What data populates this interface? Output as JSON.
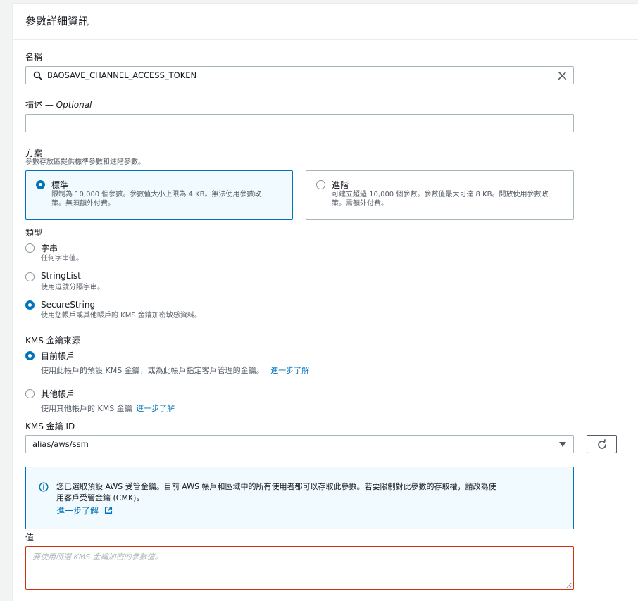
{
  "panel": {
    "title": "參數詳細資訊"
  },
  "name_field": {
    "label": "名稱",
    "value": "BAOSAVE_CHANNEL_ACCESS_TOKEN"
  },
  "description_field": {
    "label": "描述",
    "optional": "— Optional",
    "value": ""
  },
  "tier": {
    "label": "方案",
    "description": "參數存放區提供標準參數和進階參數。",
    "options": [
      {
        "title": "標準",
        "desc_line1": "限制為 10,000 個參數。參數值大小上限為 4 KB。無法使用參數政",
        "desc_line2": "策。無須額外付費。",
        "selected": true
      },
      {
        "title": "進階",
        "desc_line1": "可建立超過 10,000 個參數。參數值最大可達 8 KB。開放使用參數政",
        "desc_line2": "策。需額外付費。",
        "selected": false
      }
    ]
  },
  "type": {
    "label": "類型",
    "options": [
      {
        "title": "字串",
        "desc": "任何字串值。",
        "selected": false
      },
      {
        "title": "StringList",
        "desc": "使用逗號分隔字串。",
        "selected": false
      },
      {
        "title": "SecureString",
        "desc": "使用您帳戶或其他帳戶的 KMS 金鑰加密敏感資料。",
        "selected": true
      }
    ]
  },
  "kms_source": {
    "label": "KMS 金鑰來源",
    "options": [
      {
        "title": "目前帳戶",
        "desc": "使用此帳戶的預設 KMS 金鑰，或為此帳戶指定客戶管理的金鑰。",
        "link": "進一步了解",
        "selected": true
      },
      {
        "title": "其他帳戶",
        "desc": "使用其他帳戶的 KMS 金鑰",
        "link": "進一步了解",
        "selected": false
      }
    ]
  },
  "kms_key_id": {
    "label": "KMS 金鑰 ID",
    "value": "alias/aws/ssm"
  },
  "info": {
    "line1": "您已選取預設 AWS 受管金鑰。目前 AWS 帳戶和區域中的所有使用者都可以存取此參數。若要限制對此參數的存取權，請改為使",
    "line2": "用客戶受管金鑰 (CMK)。",
    "link": "進一步了解"
  },
  "value_field": {
    "label": "值",
    "placeholder": "要使用所選 KMS 金鑰加密的參數值。"
  },
  "colors": {
    "accent": "#0073bb",
    "error": "#d13212",
    "border": "#aab7b8",
    "info_bg": "#f1faff"
  }
}
